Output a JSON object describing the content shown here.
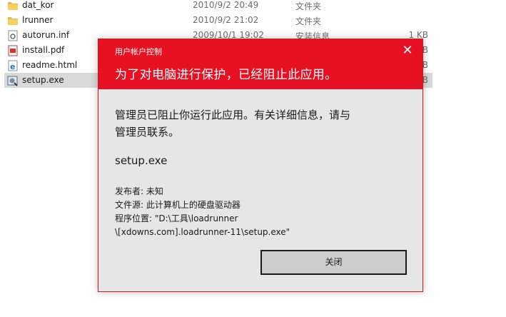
{
  "files": [
    {
      "name": "dat_kor",
      "date": "2010/9/2 20:49",
      "type": "文件夹",
      "size": "",
      "icon": "folder-icon"
    },
    {
      "name": "lrunner",
      "date": "2010/9/2 21:02",
      "type": "文件夹",
      "size": "",
      "icon": "folder-icon"
    },
    {
      "name": "autorun.inf",
      "date": "2009/10/1 19:02",
      "type": "安装信息",
      "size": "1 KB",
      "icon": "settings-file-icon"
    },
    {
      "name": "install.pdf",
      "date": "",
      "type": "",
      "size": "B",
      "icon": "pdf-file-icon"
    },
    {
      "name": "readme.html",
      "date": "",
      "type": "",
      "size": "B",
      "icon": "html-file-icon"
    },
    {
      "name": "setup.exe",
      "date": "",
      "type": "",
      "size": "B",
      "icon": "installer-file-icon"
    }
  ],
  "dialog": {
    "caption": "用户帐户控制",
    "headline": "为了对电脑进行保护，已经阻止此应用。",
    "message": "管理员已阻止你运行此应用。有关详细信息，请与管理员联系。",
    "program_name": "setup.exe",
    "publisher": "发布者: 未知",
    "file_source": "文件源: 此计算机上的硬盘驱动器",
    "location_line1": "程序位置: \"D:\\工具\\loadrunner",
    "location_line2": "\\[xdowns.com].loadrunner-11\\setup.exe\"",
    "close_button": "关闭",
    "close_glyph": "✕",
    "header_color": "#e81123"
  }
}
